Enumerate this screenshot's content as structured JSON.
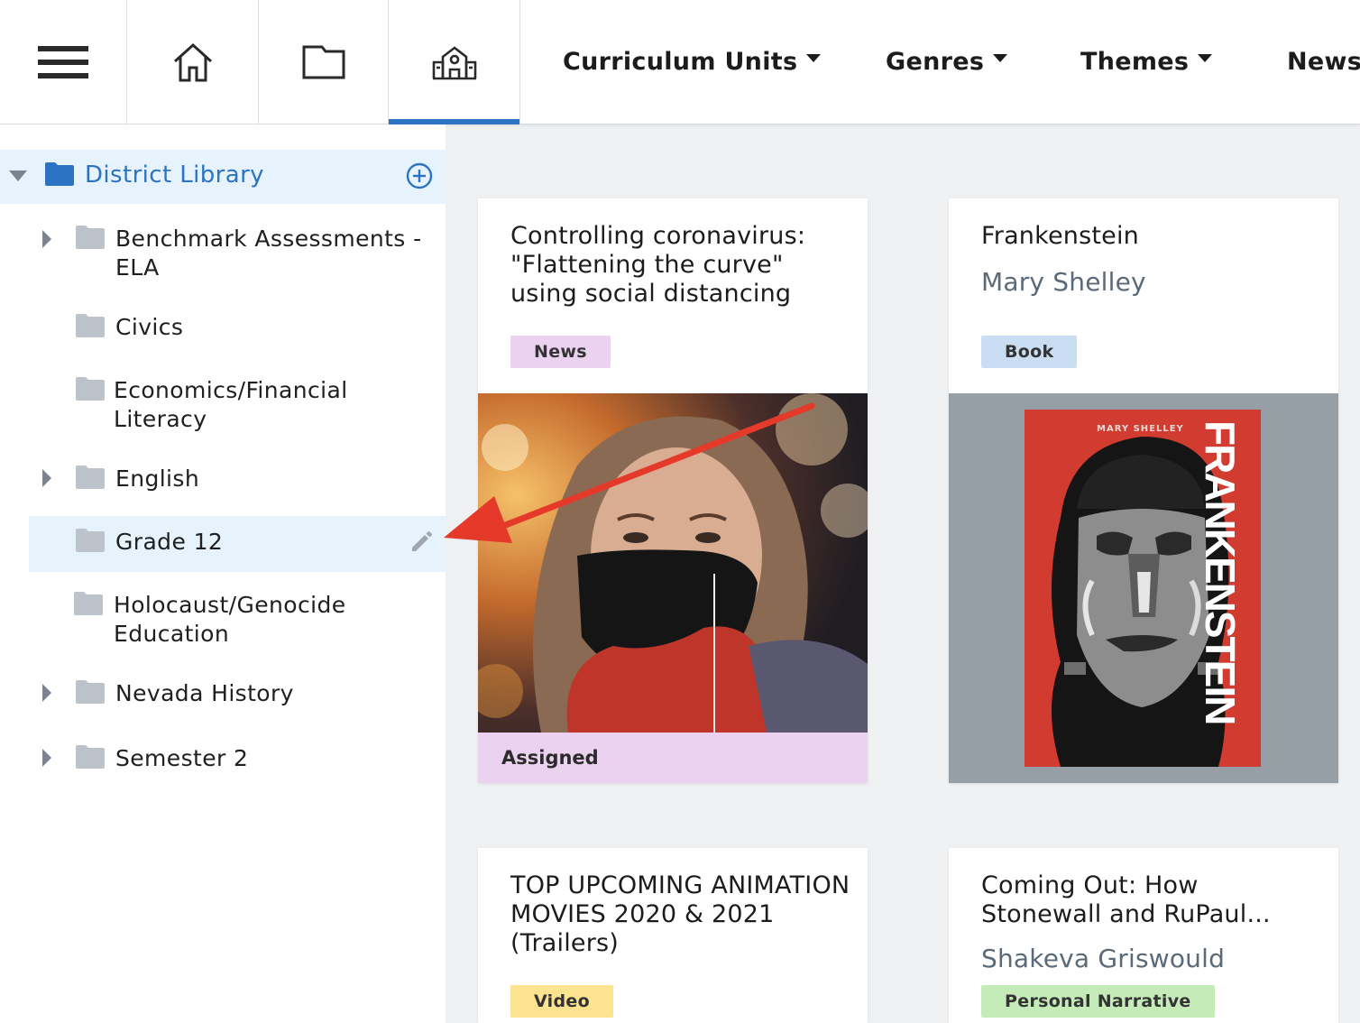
{
  "nav": {
    "icons": [
      "menu-icon",
      "home-icon",
      "folder-icon",
      "school-icon"
    ],
    "menus": [
      {
        "label": "Curriculum Units"
      },
      {
        "label": "Genres"
      },
      {
        "label": "Themes"
      },
      {
        "label": "News"
      }
    ]
  },
  "sidebar": {
    "library_title": "District Library",
    "items": [
      {
        "label": "Benchmark Assessments - ELA",
        "expandable": true
      },
      {
        "label": "Civics",
        "expandable": false
      },
      {
        "label": "Economics/Financial Literacy",
        "expandable": false
      },
      {
        "label": "English",
        "expandable": true
      },
      {
        "label": "Grade 12",
        "expandable": false,
        "selected": true
      },
      {
        "label": "Holocaust/Genocide Education",
        "expandable": false
      },
      {
        "label": "Nevada History",
        "expandable": true
      },
      {
        "label": "Semester 2",
        "expandable": true
      }
    ]
  },
  "cards": [
    {
      "title": "Controlling coronavirus: \"Flattening the curve\" using social distancing",
      "tag": "News",
      "status": "Assigned"
    },
    {
      "title": "Frankenstein",
      "author": "Mary Shelley",
      "tag": "Book",
      "cover_author": "MARY SHELLEY",
      "cover_title": "FRANKENSTEIN"
    },
    {
      "title": "TOP UPCOMING ANIMATION MOVIES 2020 & 2021 (Trailers)",
      "tag": "Video"
    },
    {
      "title": "Coming Out: How Stonewall and RuPaul...",
      "author": "Shakeva Griswould",
      "tag": "Personal Narrative"
    }
  ],
  "colors": {
    "accent": "#2d73c4",
    "arrow": "#e5392a"
  }
}
